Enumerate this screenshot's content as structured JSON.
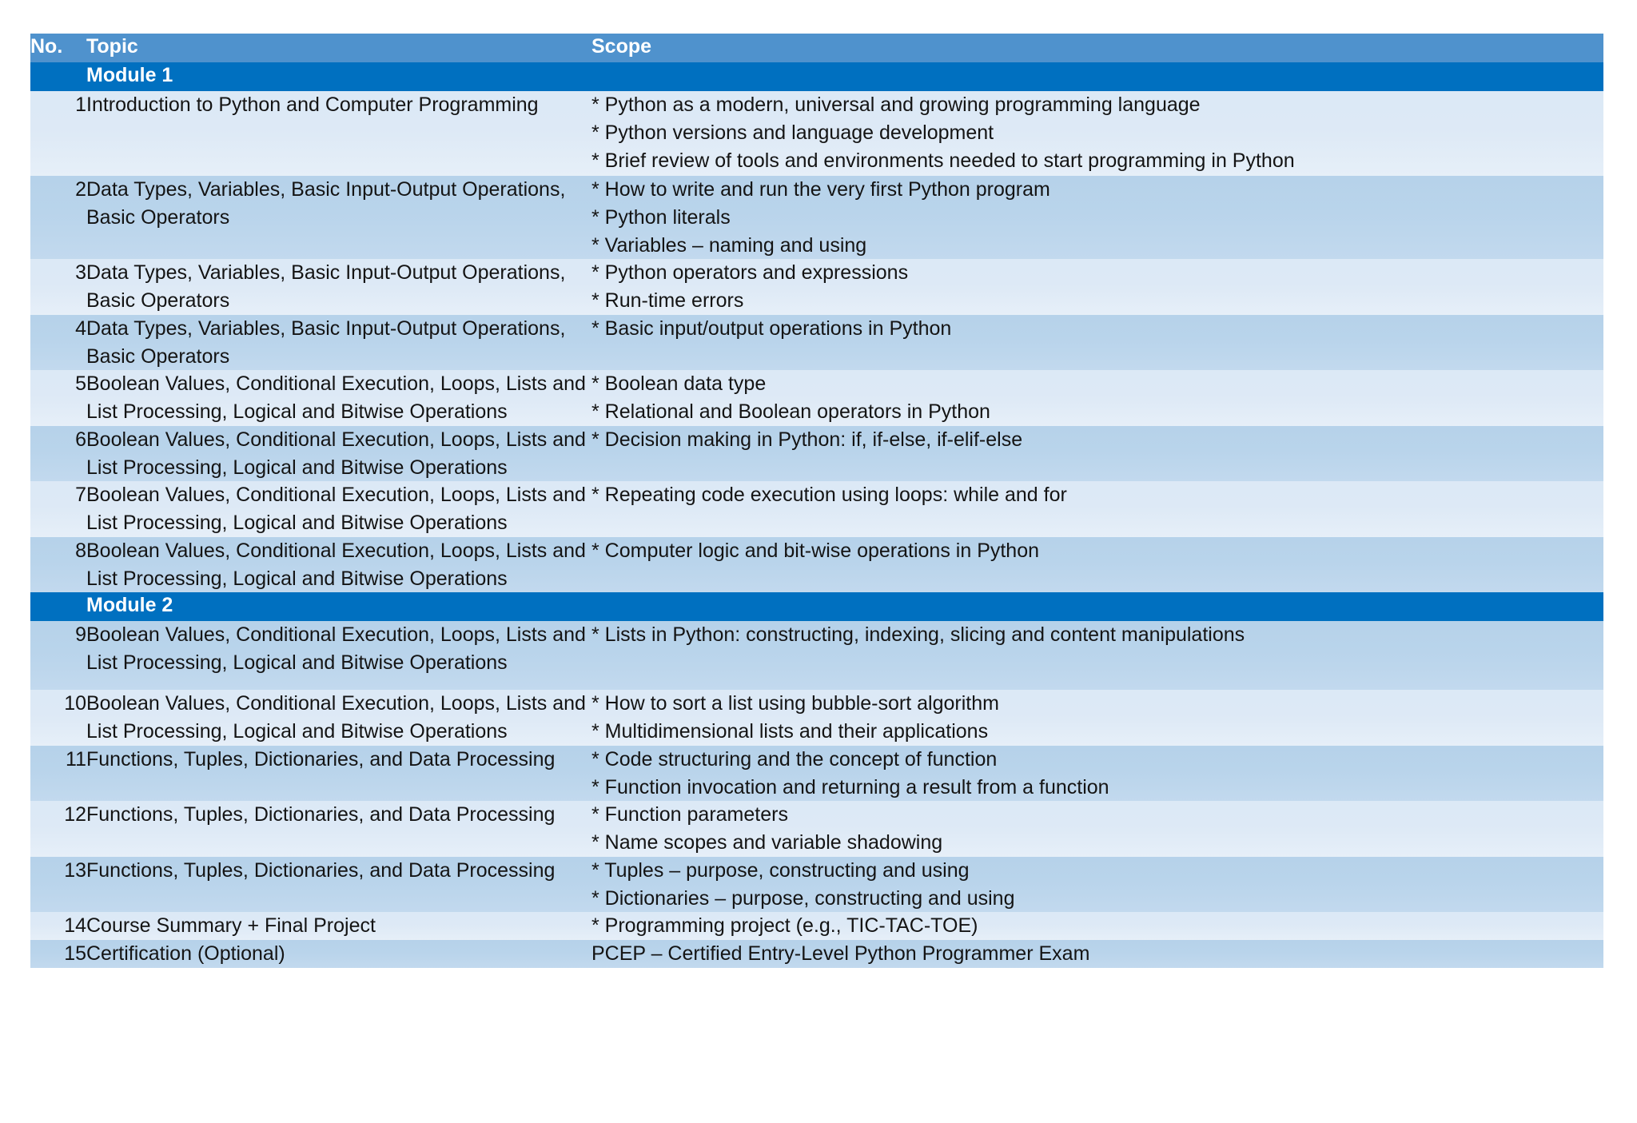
{
  "table": {
    "columns": [
      "No.",
      "Topic",
      "Scope"
    ],
    "rows": [
      {
        "kind": "module",
        "no": "",
        "topic": "Module 1",
        "scope": []
      },
      {
        "kind": "item",
        "no": "1",
        "topic": "Introduction to Python and Computer Programming",
        "scope": [
          "* Python as a modern, universal and growing programming language",
          "* Python versions and language development",
          "* Brief review of tools and environments needed to start programming in Python"
        ]
      },
      {
        "kind": "item",
        "no": "2",
        "topic": "Data Types, Variables, Basic Input-Output Operations, Basic Operators",
        "scope": [
          "* How to write and run the very first Python program",
          "* Python literals",
          "* Variables – naming and using"
        ]
      },
      {
        "kind": "item",
        "no": "3",
        "topic": "Data Types, Variables, Basic Input-Output Operations, Basic Operators",
        "scope": [
          "* Python operators and expressions",
          "* Run-time errors"
        ]
      },
      {
        "kind": "item",
        "no": "4",
        "topic": "Data Types, Variables, Basic Input-Output Operations, Basic Operators",
        "scope": [
          "* Basic input/output operations in Python"
        ]
      },
      {
        "kind": "item",
        "no": "5",
        "topic": "Boolean Values, Conditional Execution, Loops, Lists and List Processing, Logical and Bitwise Operations",
        "scope": [
          "* Boolean data type",
          "* Relational and Boolean operators in Python"
        ]
      },
      {
        "kind": "item",
        "no": "6",
        "topic": "Boolean Values, Conditional Execution, Loops, Lists and List Processing, Logical and Bitwise Operations",
        "scope": [
          "* Decision making in Python: if, if-else, if-elif-else"
        ]
      },
      {
        "kind": "item",
        "no": "7",
        "topic": "Boolean Values, Conditional Execution, Loops, Lists and List Processing, Logical and Bitwise Operations",
        "scope": [
          "* Repeating code execution using loops: while and for"
        ]
      },
      {
        "kind": "item",
        "no": "8",
        "topic": "Boolean Values, Conditional Execution, Loops, Lists and List Processing, Logical and Bitwise Operations",
        "scope": [
          "* Computer logic and bit-wise operations in Python"
        ]
      },
      {
        "kind": "module",
        "no": "",
        "topic": "Module 2",
        "scope": []
      },
      {
        "kind": "item",
        "no": "9",
        "topic": "Boolean Values, Conditional Execution, Loops, Lists and List Processing, Logical and Bitwise Operations",
        "scope": [
          "* Lists in Python: constructing, indexing, slicing and content manipulations"
        ]
      },
      {
        "kind": "item",
        "no": "10",
        "topic": "Boolean Values, Conditional Execution, Loops, Lists and List Processing, Logical and Bitwise Operations",
        "scope": [
          "* How to sort a list using bubble-sort algorithm",
          "* Multidimensional lists and their applications"
        ]
      },
      {
        "kind": "item",
        "no": "11",
        "topic": "Functions, Tuples, Dictionaries, and Data Processing",
        "scope": [
          "* Code structuring and the concept of function",
          "* Function invocation and returning a result from a function"
        ]
      },
      {
        "kind": "item",
        "no": "12",
        "topic": "Functions, Tuples, Dictionaries, and Data Processing",
        "scope": [
          "* Function parameters",
          "* Name scopes and variable shadowing"
        ]
      },
      {
        "kind": "item",
        "no": "13",
        "topic": "Functions, Tuples, Dictionaries, and Data Processing",
        "scope": [
          "* Tuples – purpose, constructing and using",
          "* Dictionaries – purpose, constructing and using"
        ]
      },
      {
        "kind": "item",
        "no": "14",
        "topic": "Course Summary + Final Project",
        "scope": [
          "* Programming project (e.g., TIC-TAC-TOE)"
        ]
      },
      {
        "kind": "item",
        "no": "15",
        "topic": "Certification (Optional)",
        "scope": [
          "PCEP – Certified Entry-Level Python Programmer Exam"
        ]
      }
    ]
  },
  "colors": {
    "header_blue": "#4f92cd",
    "module_blue": "#0070c0",
    "row_light": "#dce9f6",
    "row_dark": "#b6d2ea",
    "text": "#141414",
    "header_text": "#ffffff",
    "page_background": "#ffffff"
  }
}
